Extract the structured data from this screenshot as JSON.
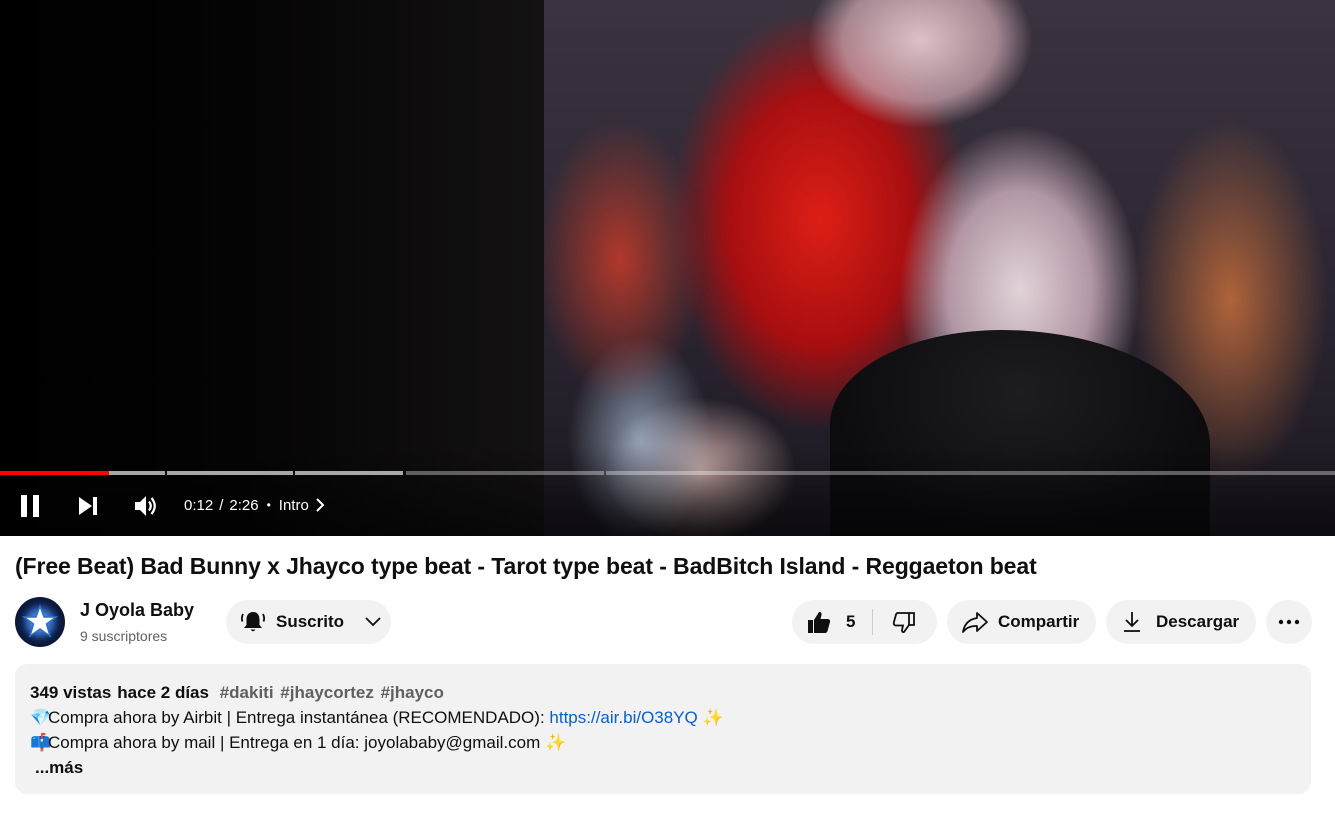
{
  "player": {
    "current_time": "0:12",
    "separator": "/",
    "duration": "2:26",
    "chapter_dot": "•",
    "chapter": "Intro",
    "progress_played_fraction": 0.082,
    "chapter_segments_end_fractions": [
      0.124,
      0.22,
      0.303,
      0.453,
      1.0
    ],
    "buffered_fraction": 0.303,
    "colors": {
      "played": "#ff0000"
    }
  },
  "video": {
    "title": "(Free Beat) Bad Bunny x Jhayco type beat - Tarot type beat - BadBitch Island - Reggaeton beat"
  },
  "channel": {
    "name": "J Oyola Baby",
    "subscribers": "9 suscriptores",
    "subscribe_label": "Suscrito"
  },
  "actions": {
    "likes": "5",
    "share_label": "Compartir",
    "download_label": "Descargar"
  },
  "description": {
    "views": "349 vistas",
    "date": "hace 2 días",
    "tags": [
      "#dakiti",
      "#jhaycortez",
      "#jhayco"
    ],
    "line1_emoji": "💎",
    "line1_text": "Compra ahora by Airbit | Entrega instantánea (RECOMENDADO): ",
    "line1_link": "https://air.bi/O38YQ",
    "line1_suffix": "✨",
    "line2_emoji": "📫",
    "line2_text": "Compra ahora by mail | Entrega en 1 día: joyolababy@gmail.com ",
    "line2_suffix": "✨",
    "more_label": "...más",
    "colors": {
      "link": "#065fd4",
      "tags": "#606060"
    }
  }
}
